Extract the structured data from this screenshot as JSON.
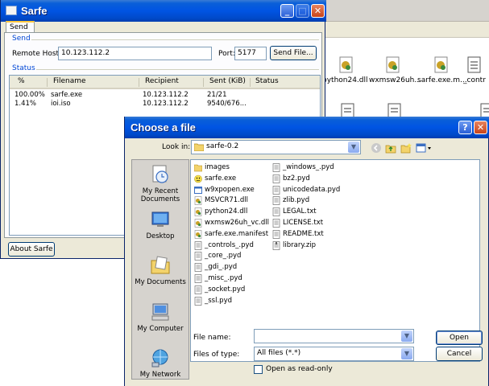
{
  "background_window": {
    "files": [
      {
        "label": "python24.dll",
        "icon": "dll-icon"
      },
      {
        "label": "wxmsw26uh...",
        "icon": "dll-icon"
      },
      {
        "label": "sarfe.exe.m...",
        "icon": "manifest-icon"
      },
      {
        "label": "_contr",
        "icon": "pyd-icon"
      }
    ]
  },
  "sarfe": {
    "title": "Sarfe",
    "tab": "Send",
    "send_group": "Send",
    "remote_host_label": "Remote Host:",
    "remote_host_value": "10.123.112.2",
    "port_label": "Port:",
    "port_value": "5177",
    "send_file_button": "Send File...",
    "status_group": "Status",
    "columns": [
      "%",
      "Filename",
      "Recipient",
      "Sent (KiB)",
      "Status"
    ],
    "rows": [
      {
        "percent": "100.00%",
        "filename": "sarfe.exe",
        "recipient": "10.123.112.2",
        "sent": "21/21",
        "status": ""
      },
      {
        "percent": "1.41%",
        "filename": "ioi.iso",
        "recipient": "10.123.112.2",
        "sent": "9540/676...",
        "status": ""
      }
    ],
    "about_button": "About Sarfe"
  },
  "dialog": {
    "title": "Choose a file",
    "help_button": "?",
    "close_button": "X",
    "look_in_label": "Look in:",
    "look_in_value": "sarfe-0.2",
    "places": [
      "My Recent Documents",
      "Desktop",
      "My Documents",
      "My Computer",
      "My Network"
    ],
    "files_col1": [
      {
        "name": "images",
        "icon": "folder-icon"
      },
      {
        "name": "sarfe.exe",
        "icon": "smiley-exe-icon"
      },
      {
        "name": "w9xpopen.exe",
        "icon": "exe-icon"
      },
      {
        "name": "MSVCR71.dll",
        "icon": "dll-icon"
      },
      {
        "name": "python24.dll",
        "icon": "dll-icon"
      },
      {
        "name": "wxmsw26uh_vc.dll",
        "icon": "dll-icon"
      },
      {
        "name": "sarfe.exe.manifest",
        "icon": "manifest-icon"
      },
      {
        "name": "_controls_.pyd",
        "icon": "pyd-icon"
      },
      {
        "name": "_core_.pyd",
        "icon": "pyd-icon"
      },
      {
        "name": "_gdi_.pyd",
        "icon": "pyd-icon"
      },
      {
        "name": "_misc_.pyd",
        "icon": "pyd-icon"
      },
      {
        "name": "_socket.pyd",
        "icon": "pyd-icon"
      },
      {
        "name": "_ssl.pyd",
        "icon": "pyd-icon"
      }
    ],
    "files_col2": [
      {
        "name": "_windows_.pyd",
        "icon": "pyd-icon"
      },
      {
        "name": "bz2.pyd",
        "icon": "pyd-icon"
      },
      {
        "name": "unicodedata.pyd",
        "icon": "pyd-icon"
      },
      {
        "name": "zlib.pyd",
        "icon": "pyd-icon"
      },
      {
        "name": "LEGAL.txt",
        "icon": "text-icon"
      },
      {
        "name": "LICENSE.txt",
        "icon": "text-icon"
      },
      {
        "name": "README.txt",
        "icon": "text-icon"
      },
      {
        "name": "library.zip",
        "icon": "zip-icon"
      }
    ],
    "file_name_label": "File name:",
    "file_name_value": "",
    "files_of_type_label": "Files of type:",
    "files_of_type_value": "All files (*.*)",
    "open_readonly_label": "Open as read-only",
    "open_button": "Open",
    "cancel_button": "Cancel"
  },
  "colors": {
    "title_blue": "#0054e3",
    "window_face": "#ece9d8",
    "group_label": "#0046d5"
  }
}
